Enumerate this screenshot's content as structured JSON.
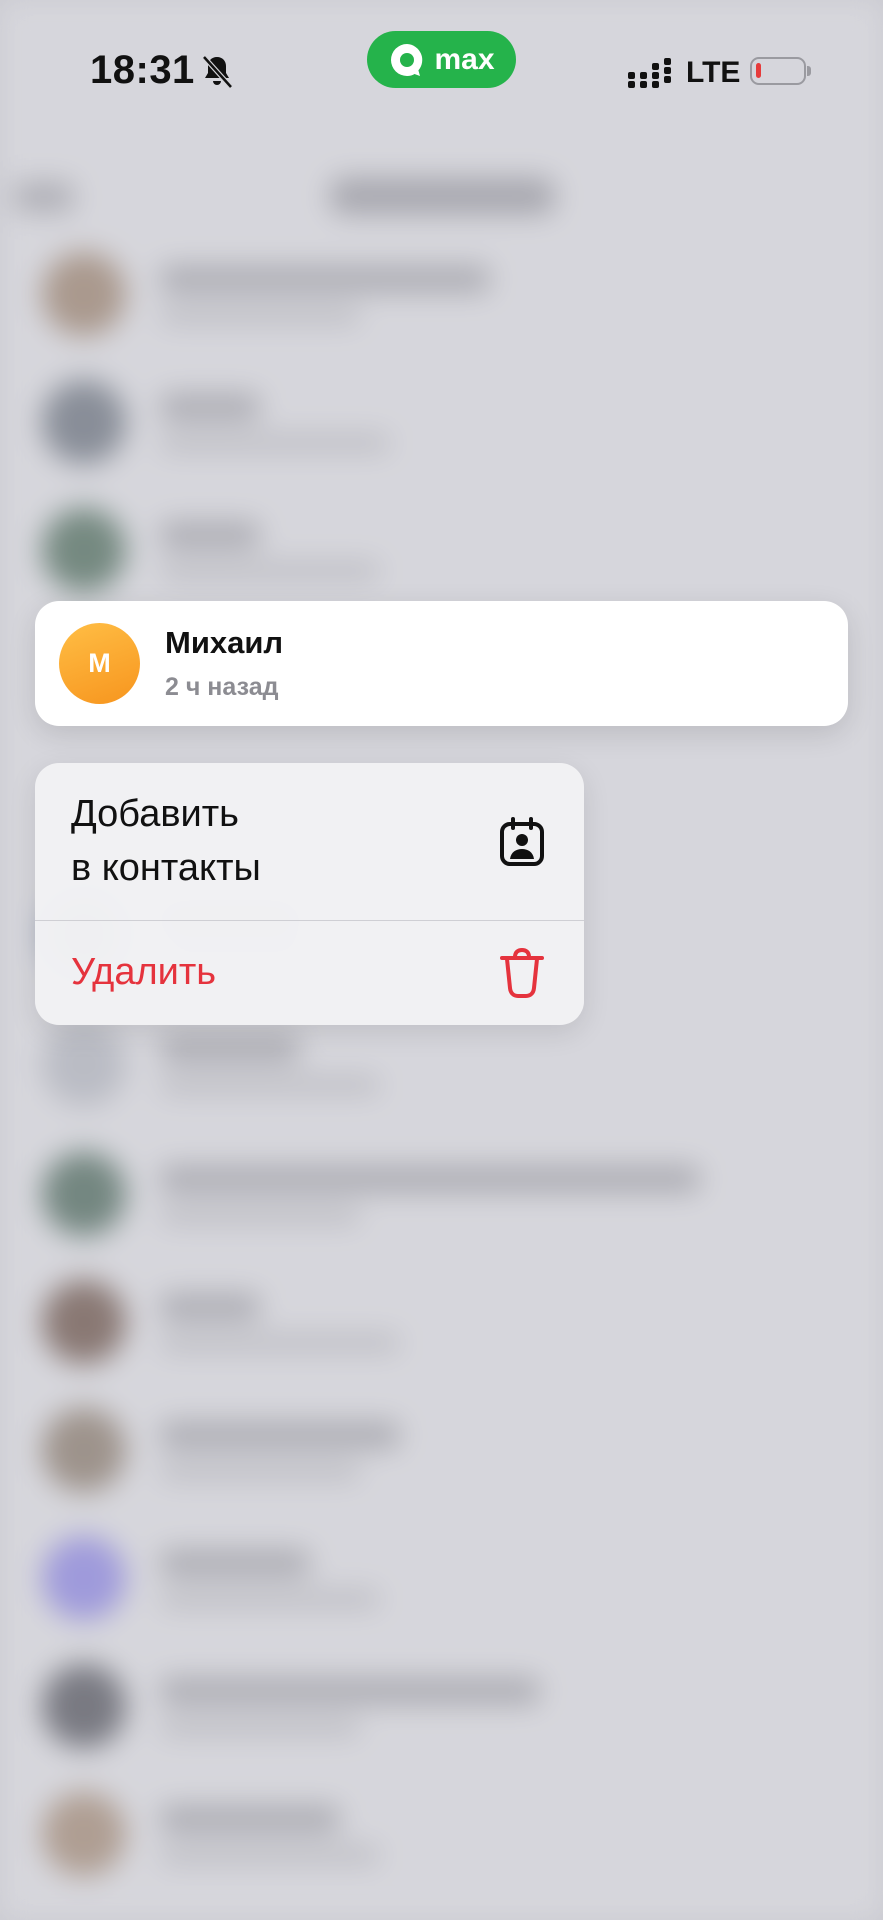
{
  "status_bar": {
    "time": "18:31",
    "app_badge": "max",
    "network": "LTE",
    "icons": [
      "bell-muted-icon",
      "max-logo-icon",
      "signal-icon",
      "battery-low-icon"
    ]
  },
  "contact_preview": {
    "avatar_initial": "М",
    "name": "Михаил",
    "last_seen": "2 ч назад",
    "avatar_color": "#f7951e"
  },
  "context_menu": {
    "add_line1": "Добавить",
    "add_line2": "в контакты",
    "add_icon": "contact-card-icon",
    "delete_label": "Удалить",
    "delete_icon": "trash-icon",
    "delete_color": "#e5333d"
  },
  "colors": {
    "badge_green": "#25b34b",
    "battery_red": "#e63b3b"
  }
}
